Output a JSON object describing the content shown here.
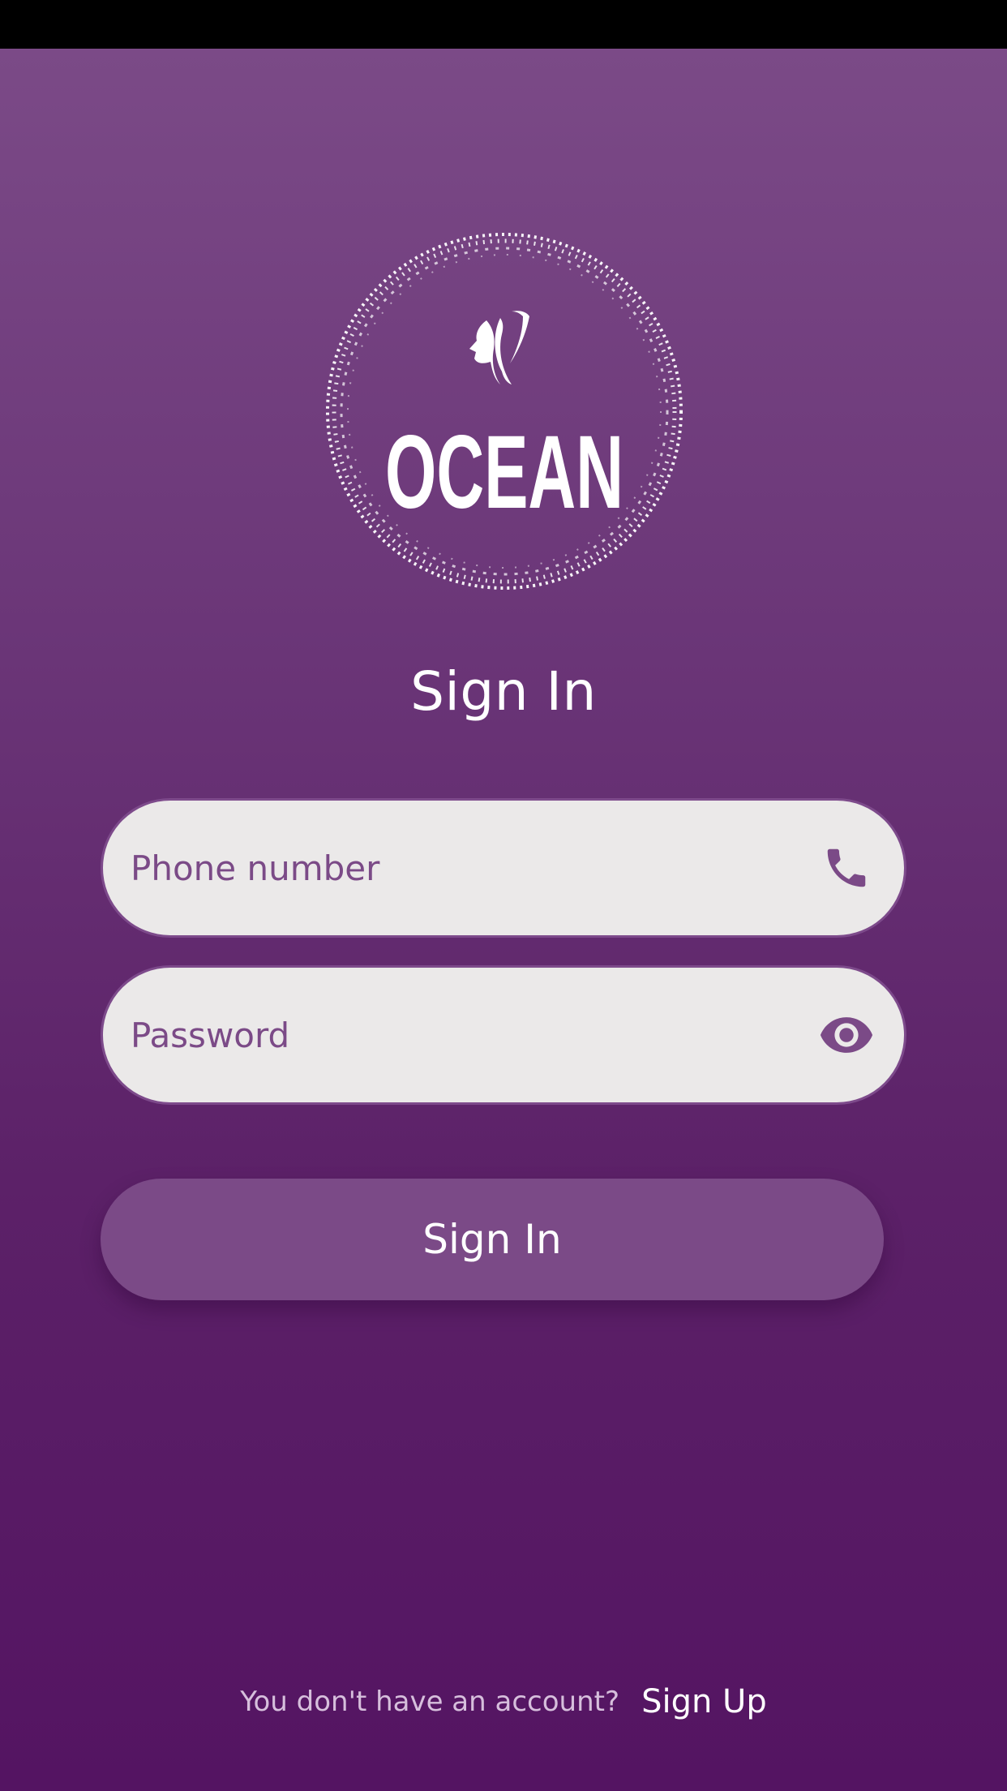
{
  "logo": {
    "brand": "OCEAN",
    "icon": "woman-silhouette-icon"
  },
  "title": "Sign In",
  "phone_field": {
    "placeholder": "Phone number",
    "value": "",
    "icon": "phone-icon"
  },
  "password_field": {
    "placeholder": "Password",
    "value": "",
    "icon": "eye-icon"
  },
  "sign_in_button": {
    "label": "Sign In"
  },
  "footer": {
    "prompt": "You don't have an account?",
    "link": "Sign Up"
  },
  "colors": {
    "background_top": "#7b4a87",
    "background_bottom": "#541462",
    "field_background": "#ebe9e9",
    "accent": "#7b4a87",
    "text_light": "#ffffff"
  }
}
